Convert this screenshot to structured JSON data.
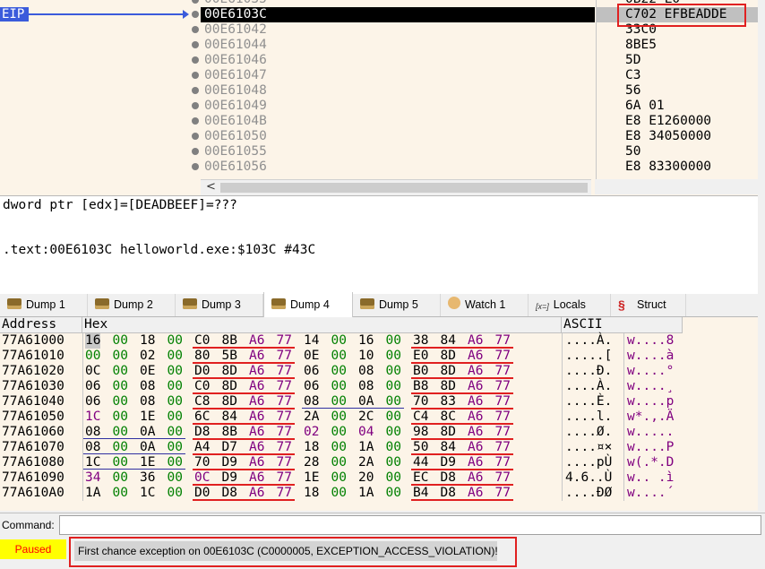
{
  "disasm": {
    "eip_label": "EIP",
    "partial_top_addr": "00E61035",
    "partial_top_bytes": "0B22 L0",
    "rows": [
      {
        "addr": "00E6103C",
        "bytes": "C702 EFBEADDE",
        "current": true
      },
      {
        "addr": "00E61042",
        "bytes": "33C0"
      },
      {
        "addr": "00E61044",
        "bytes": "8BE5"
      },
      {
        "addr": "00E61046",
        "bytes": "5D"
      },
      {
        "addr": "00E61047",
        "bytes": "C3"
      },
      {
        "addr": "00E61048",
        "bytes": "56"
      },
      {
        "addr": "00E61049",
        "bytes": "6A 01"
      },
      {
        "addr": "00E6104B",
        "bytes": "E8 E1260000"
      },
      {
        "addr": "00E61050",
        "bytes": "E8 34050000"
      },
      {
        "addr": "00E61055",
        "bytes": "50"
      },
      {
        "addr": "00E61056",
        "bytes": "E8 83300000"
      }
    ],
    "scroll_left": "<"
  },
  "info": {
    "line1": "dword ptr [edx]=[DEADBEEF]=???",
    "line2": ".text:00E6103C helloworld.exe:$103C #43C"
  },
  "tabs": [
    {
      "label": "Dump 1",
      "icon": "dump-icon"
    },
    {
      "label": "Dump 2",
      "icon": "dump-icon"
    },
    {
      "label": "Dump 3",
      "icon": "dump-icon"
    },
    {
      "label": "Dump 4",
      "icon": "dump-icon",
      "active": true
    },
    {
      "label": "Dump 5",
      "icon": "dump-icon"
    },
    {
      "label": "Watch 1",
      "icon": "watch-icon"
    },
    {
      "label": "Locals",
      "icon": "locals-icon",
      "icon_text": "[x=]"
    },
    {
      "label": "Struct",
      "icon": "struct-icon"
    }
  ],
  "dump": {
    "headers": {
      "address": "Address",
      "hex": "Hex",
      "ascii": "ASCII"
    },
    "rows": [
      {
        "addr": "77A61000",
        "hex": [
          "16",
          "00",
          "18",
          "00",
          "C0",
          "8B",
          "A6",
          "77",
          "14",
          "00",
          "16",
          "00",
          "38",
          "84",
          "A6",
          "77"
        ],
        "ascii1": "....À.",
        "ascii2": "w....8"
      },
      {
        "addr": "77A61010",
        "hex": [
          "00",
          "00",
          "02",
          "00",
          "80",
          "5B",
          "A6",
          "77",
          "0E",
          "00",
          "10",
          "00",
          "E0",
          "8D",
          "A6",
          "77"
        ],
        "ascii1": ".....[",
        "ascii2": "w....à"
      },
      {
        "addr": "77A61020",
        "hex": [
          "0C",
          "00",
          "0E",
          "00",
          "D0",
          "8D",
          "A6",
          "77",
          "06",
          "00",
          "08",
          "00",
          "B0",
          "8D",
          "A6",
          "77"
        ],
        "ascii1": "....Ð.",
        "ascii2": "w....°"
      },
      {
        "addr": "77A61030",
        "hex": [
          "06",
          "00",
          "08",
          "00",
          "C0",
          "8D",
          "A6",
          "77",
          "06",
          "00",
          "08",
          "00",
          "B8",
          "8D",
          "A6",
          "77"
        ],
        "ascii1": "....À.",
        "ascii2": "w....¸"
      },
      {
        "addr": "77A61040",
        "hex": [
          "06",
          "00",
          "08",
          "00",
          "C8",
          "8D",
          "A6",
          "77",
          "08",
          "00",
          "0A",
          "00",
          "70",
          "83",
          "A6",
          "77"
        ],
        "ascii1": "....È.",
        "ascii2": "w....p"
      },
      {
        "addr": "77A61050",
        "hex": [
          "1C",
          "00",
          "1E",
          "00",
          "6C",
          "84",
          "A6",
          "77",
          "2A",
          "00",
          "2C",
          "00",
          "C4",
          "8C",
          "A6",
          "77"
        ],
        "ascii1": "....l.",
        "ascii2": "w*.,.Ä"
      },
      {
        "addr": "77A61060",
        "hex": [
          "08",
          "00",
          "0A",
          "00",
          "D8",
          "8B",
          "A6",
          "77",
          "02",
          "00",
          "04",
          "00",
          "98",
          "8D",
          "A6",
          "77"
        ],
        "ascii1": "....Ø.",
        "ascii2": "w....."
      },
      {
        "addr": "77A61070",
        "hex": [
          "08",
          "00",
          "0A",
          "00",
          "A4",
          "D7",
          "A6",
          "77",
          "18",
          "00",
          "1A",
          "00",
          "50",
          "84",
          "A6",
          "77"
        ],
        "ascii1": "....¤×",
        "ascii2": "w....P"
      },
      {
        "addr": "77A61080",
        "hex": [
          "1C",
          "00",
          "1E",
          "00",
          "70",
          "D9",
          "A6",
          "77",
          "28",
          "00",
          "2A",
          "00",
          "44",
          "D9",
          "A6",
          "77"
        ],
        "ascii1": "....pÙ",
        "ascii2": "w(.*.D"
      },
      {
        "addr": "77A61090",
        "hex": [
          "34",
          "00",
          "36",
          "00",
          "0C",
          "D9",
          "A6",
          "77",
          "1E",
          "00",
          "20",
          "00",
          "EC",
          "D8",
          "A6",
          "77"
        ],
        "ascii1": "4.6..Ù",
        "ascii2": "w.. .ì"
      },
      {
        "addr": "77A610A0",
        "hex": [
          "1A",
          "00",
          "1C",
          "00",
          "D0",
          "D8",
          "A6",
          "77",
          "18",
          "00",
          "1A",
          "00",
          "B4",
          "D8",
          "A6",
          "77"
        ],
        "ascii1": "....ÐØ",
        "ascii2": "w....´"
      }
    ]
  },
  "command": {
    "label": "Command:",
    "value": ""
  },
  "status": {
    "state": "Paused",
    "message": "First chance exception on 00E6103C (C0000005, EXCEPTION_ACCESS_VIOLATION)!"
  },
  "colors": {
    "eip_bg": "#3b5bdb",
    "highlight_red": "#e02020",
    "hex_green": "#008000",
    "hex_purple": "#800080",
    "underline_red": "#e02020",
    "underline_blue": "#3030a0",
    "paused_bg": "#ffff00",
    "paused_fg": "#ff0000"
  }
}
